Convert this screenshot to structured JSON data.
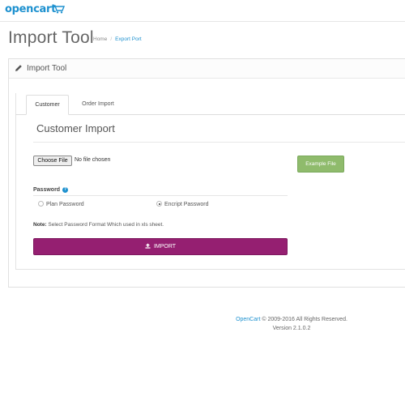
{
  "header": {
    "logo_text": "opencart"
  },
  "page": {
    "title": "Import Tool",
    "breadcrumb": {
      "home": "Home",
      "separator": "/",
      "current": "Export Port"
    }
  },
  "panel": {
    "title": "Import Tool",
    "tabs": [
      {
        "label": "Customer",
        "active": true
      },
      {
        "label": "Order Import",
        "active": false
      }
    ]
  },
  "customer_import": {
    "section_title": "Customer Import",
    "file_input": {
      "button_label": "Choose File",
      "status_text": "No file chosen"
    },
    "example_button_label": "Example File",
    "password": {
      "label": "Password",
      "help_icon": "question-circle-icon",
      "options": [
        {
          "label": "Plan Password",
          "selected": false
        },
        {
          "label": "Encript Password",
          "selected": true
        }
      ]
    },
    "note": {
      "prefix": "Note:",
      "text": " Select Password Format Which used in xls sheet."
    },
    "import_button_label": "IMPORT"
  },
  "footer": {
    "brand": "OpenCart",
    "copyright": " © 2009-2016 All Rights Reserved.",
    "version": "Version 2.1.0.2"
  },
  "colors": {
    "brand_blue": "#1e91cf",
    "import_button": "#951f71",
    "example_button": "#8fbb6c"
  }
}
